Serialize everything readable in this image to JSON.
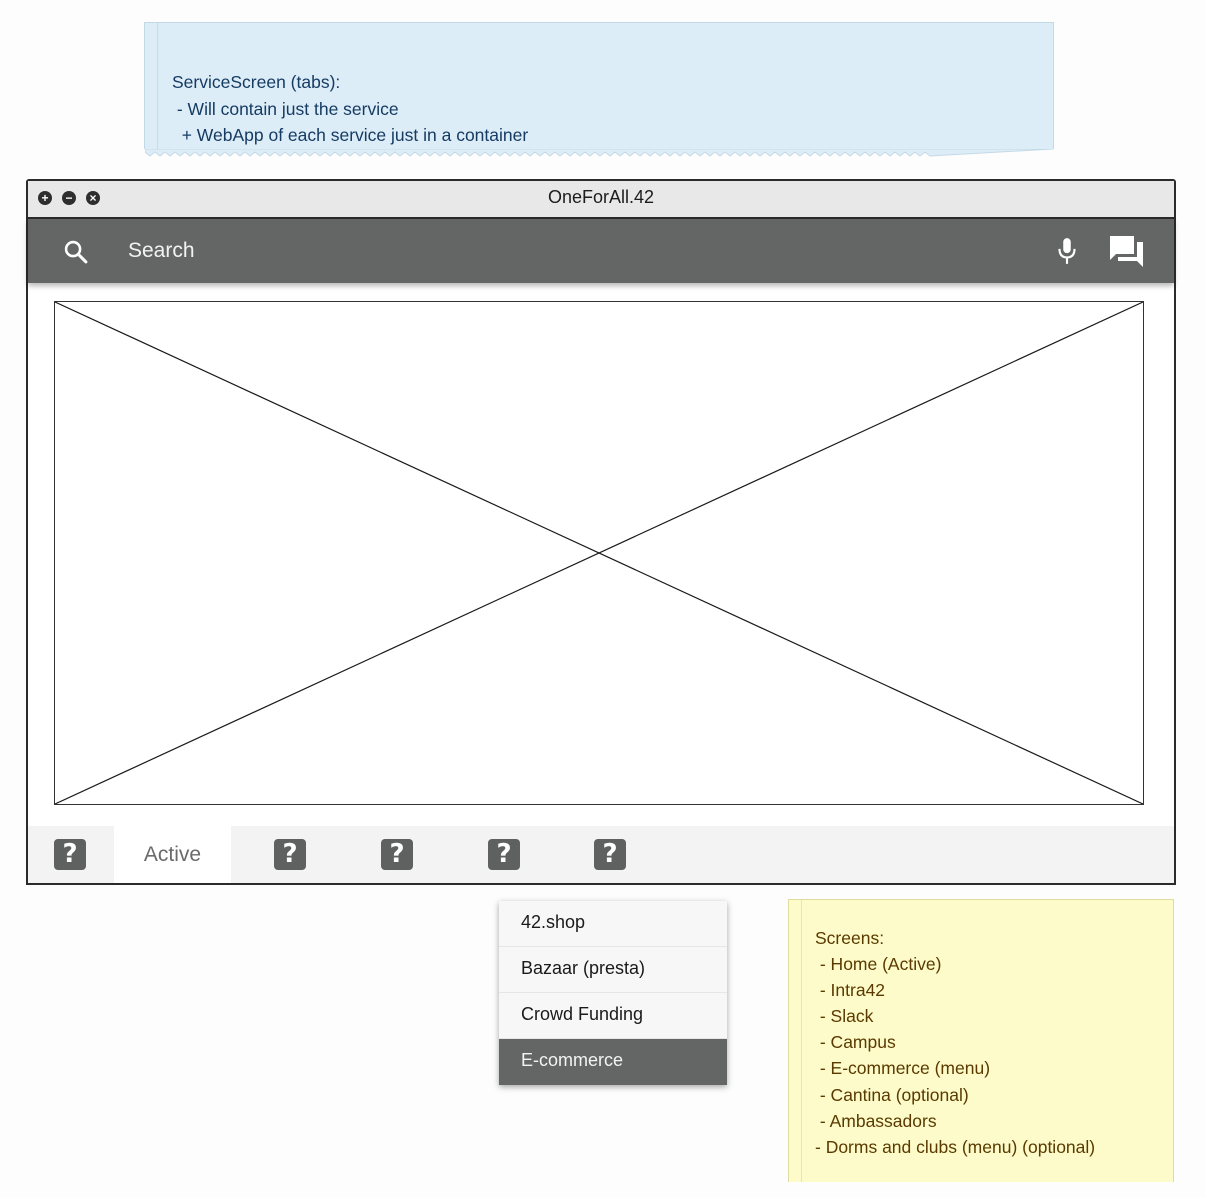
{
  "note_blue": {
    "lines": [
      "ServiceScreen (tabs):",
      " - Will contain just the service",
      "  + WebApp of each service just in a container"
    ]
  },
  "window": {
    "title": "OneForAll.42",
    "controls": [
      "plus-icon",
      "minus-icon",
      "close-icon"
    ]
  },
  "appbar": {
    "search_placeholder": "Search",
    "icons": [
      "search-icon",
      "microphone-icon",
      "chat-icon"
    ]
  },
  "tabbar": {
    "tabs": [
      {
        "icon": "question-icon",
        "label": ""
      },
      {
        "icon": "",
        "label": "Active"
      },
      {
        "icon": "question-icon",
        "label": ""
      },
      {
        "icon": "question-icon",
        "label": ""
      },
      {
        "icon": "question-icon",
        "label": ""
      },
      {
        "icon": "question-icon",
        "label": ""
      }
    ],
    "active_index": 1,
    "question_glyph": "?"
  },
  "menu": {
    "items": [
      "42.shop",
      "Bazaar (presta)",
      "Crowd Funding",
      "E-commerce"
    ],
    "selected_index": 3
  },
  "note_yellow": {
    "lines": [
      "Screens:",
      " - Home (Active)",
      " - Intra42",
      " - Slack",
      " - Campus",
      " - E-commerce (menu)",
      " - Cantina (optional)",
      " - Ambassadors",
      "- Dorms and clubs (menu) (optional)"
    ]
  },
  "colors": {
    "appbar": "#646665",
    "note_blue_bg": "#dcedf7",
    "note_blue_text": "#163b63",
    "note_yellow_bg": "#fdfbc9",
    "note_yellow_text": "#5a3a00",
    "menu_selected": "#646665"
  }
}
